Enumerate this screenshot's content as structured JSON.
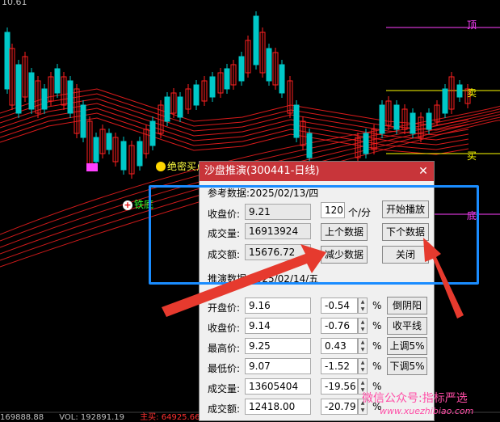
{
  "chart_labels": {
    "top": "顶",
    "bottom": "底",
    "sell": "卖",
    "buy": "买"
  },
  "signals": {
    "secret_buy": "绝密买点",
    "iron_bottom": "铁底"
  },
  "corner_value": "10.61",
  "status_bar": {
    "left": "169888.88",
    "vol": "VOL: 192891.19",
    "main": "主买: 64925.66"
  },
  "dialog": {
    "title": "沙盘推演(300441-日线)",
    "reference_header": "参考数据:2025/02/13/四",
    "fields": {
      "close_label": "收盘价:",
      "close": "9.21",
      "volume_label": "成交量:",
      "volume": "16913924",
      "amount_label": "成交额:",
      "amount": "15676.72"
    },
    "speed": {
      "value": "120",
      "unit": "个/分"
    },
    "buttons": {
      "start": "开始播放",
      "prev": "上个数据",
      "next": "下个数据",
      "reduce": "减少数据",
      "close": "关闭"
    },
    "deduce_header": "推演数据:2025/02/14/五",
    "rows": [
      {
        "label": "开盘价:",
        "value": "9.16",
        "pct": "-0.54",
        "btn": "倒阴阳"
      },
      {
        "label": "收盘价:",
        "value": "9.14",
        "pct": "-0.76",
        "btn": "收平线"
      },
      {
        "label": "最高价:",
        "value": "9.25",
        "pct": "0.43",
        "btn": "上调5%"
      },
      {
        "label": "最低价:",
        "value": "9.07",
        "pct": "-1.52",
        "btn": "下调5%"
      },
      {
        "label": "成交量:",
        "value": "13605404",
        "pct": "-19.56",
        "btn": ""
      },
      {
        "label": "成交额:",
        "value": "12418.00",
        "pct": "-20.79",
        "btn": ""
      }
    ],
    "pct_sign": "%"
  },
  "watermark": {
    "line1": "微信公众号:指标严选",
    "line2": "www.xuezhibiao.com"
  },
  "colors": {
    "up": "#ff2020",
    "down": "#00c8c8",
    "highlight": "#1a8cff",
    "arrow": "#e63a2e"
  }
}
